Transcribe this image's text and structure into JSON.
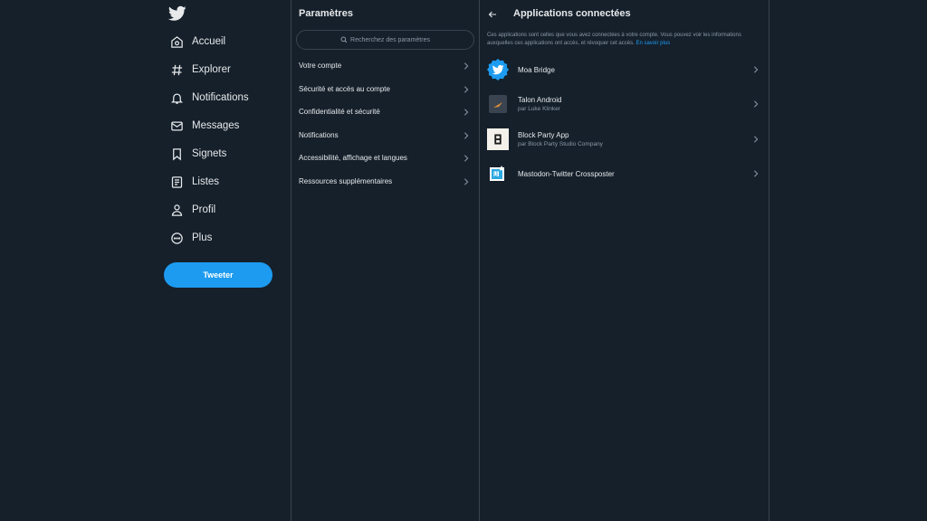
{
  "nav": {
    "logo": "twitter-bird-icon",
    "items": [
      {
        "label": "Accueil",
        "icon": "home-icon"
      },
      {
        "label": "Explorer",
        "icon": "hashtag-icon"
      },
      {
        "label": "Notifications",
        "icon": "bell-icon"
      },
      {
        "label": "Messages",
        "icon": "envelope-icon"
      },
      {
        "label": "Signets",
        "icon": "bookmark-icon"
      },
      {
        "label": "Listes",
        "icon": "list-icon"
      },
      {
        "label": "Profil",
        "icon": "person-icon"
      },
      {
        "label": "Plus",
        "icon": "more-circle-icon"
      }
    ],
    "tweet_label": "Tweeter"
  },
  "settings": {
    "title": "Paramètres",
    "search_placeholder": "Recherchez des paramètres",
    "items": [
      {
        "label": "Votre compte"
      },
      {
        "label": "Sécurité et accès au compte"
      },
      {
        "label": "Confidentialité et sécurité"
      },
      {
        "label": "Notifications"
      },
      {
        "label": "Accessibilité, affichage et langues"
      },
      {
        "label": "Ressources supplémentaires"
      }
    ]
  },
  "apps": {
    "title": "Applications connectées",
    "description": "Ces applications sont celles que vous avez connectées à votre compte. Vous pouvez voir les informations auxquelles ces applications ont accès, et révoquer cet accès.",
    "learn_more": "En savoir plus",
    "items": [
      {
        "name": "Moa Bridge",
        "by": ""
      },
      {
        "name": "Talon Android",
        "by": "par Luke Klinker"
      },
      {
        "name": "Block Party App",
        "by": "par Block Party Studio Company"
      },
      {
        "name": "Mastodon-Twitter Crossposter",
        "by": ""
      }
    ]
  },
  "colors": {
    "background": "#15202b",
    "accent": "#1d9bf0",
    "border": "#38444d",
    "text_secondary": "#8b98a5"
  }
}
